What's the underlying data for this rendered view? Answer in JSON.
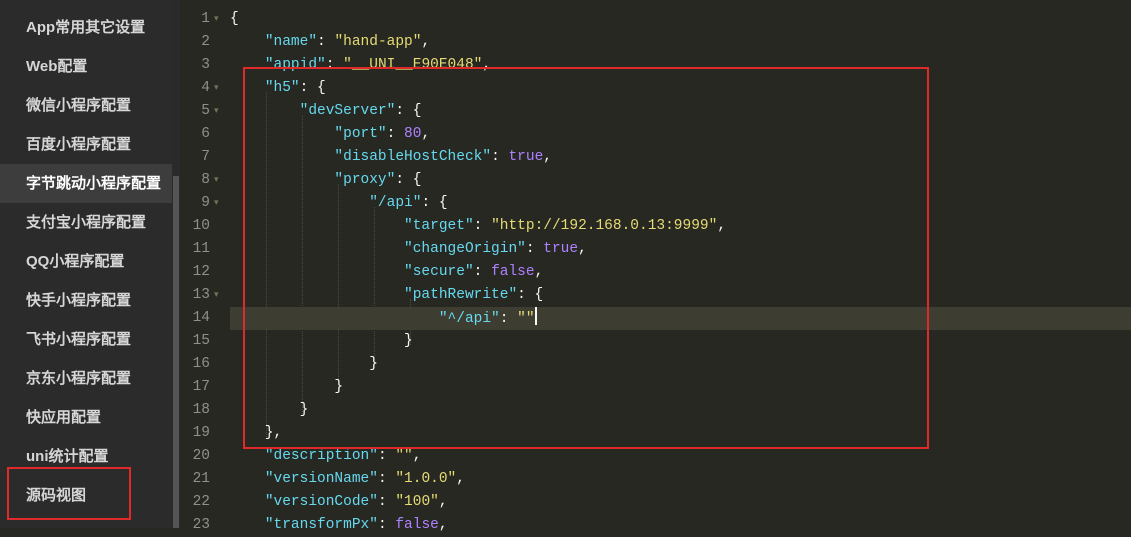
{
  "sidebar": {
    "items": [
      {
        "label": "App常用其它设置"
      },
      {
        "label": "Web配置"
      },
      {
        "label": "微信小程序配置"
      },
      {
        "label": "百度小程序配置"
      },
      {
        "label": "字节跳动小程序配置"
      },
      {
        "label": "支付宝小程序配置"
      },
      {
        "label": "QQ小程序配置"
      },
      {
        "label": "快手小程序配置"
      },
      {
        "label": "飞书小程序配置"
      },
      {
        "label": "京东小程序配置"
      },
      {
        "label": "快应用配置"
      },
      {
        "label": "uni统计配置"
      },
      {
        "label": "源码视图"
      }
    ],
    "active_index": 4
  },
  "editor": {
    "lines": [
      {
        "num": "1",
        "fold": true,
        "tokens": [
          [
            "p",
            "{"
          ]
        ]
      },
      {
        "num": "2",
        "fold": false,
        "tokens": [
          [
            "p",
            "    "
          ],
          [
            "k",
            "\"name\""
          ],
          [
            "p",
            ": "
          ],
          [
            "s",
            "\"hand-app\""
          ],
          [
            "p",
            ","
          ]
        ]
      },
      {
        "num": "3",
        "fold": false,
        "tokens": [
          [
            "p",
            "    "
          ],
          [
            "k",
            "\"appid\""
          ],
          [
            "p",
            ": "
          ],
          [
            "s",
            "\"__UNI__E90E048\""
          ],
          [
            "p",
            ","
          ]
        ]
      },
      {
        "num": "4",
        "fold": true,
        "tokens": [
          [
            "p",
            "    "
          ],
          [
            "k",
            "\"h5\""
          ],
          [
            "p",
            ": {"
          ]
        ]
      },
      {
        "num": "5",
        "fold": true,
        "tokens": [
          [
            "p",
            "        "
          ],
          [
            "k",
            "\"devServer\""
          ],
          [
            "p",
            ": {"
          ]
        ]
      },
      {
        "num": "6",
        "fold": false,
        "tokens": [
          [
            "p",
            "            "
          ],
          [
            "k",
            "\"port\""
          ],
          [
            "p",
            ": "
          ],
          [
            "n",
            "80"
          ],
          [
            "p",
            ","
          ]
        ]
      },
      {
        "num": "7",
        "fold": false,
        "tokens": [
          [
            "p",
            "            "
          ],
          [
            "k",
            "\"disableHostCheck\""
          ],
          [
            "p",
            ": "
          ],
          [
            "b",
            "true"
          ],
          [
            "p",
            ","
          ]
        ]
      },
      {
        "num": "8",
        "fold": true,
        "tokens": [
          [
            "p",
            "            "
          ],
          [
            "k",
            "\"proxy\""
          ],
          [
            "p",
            ": {"
          ]
        ]
      },
      {
        "num": "9",
        "fold": true,
        "tokens": [
          [
            "p",
            "                "
          ],
          [
            "k",
            "\"/api\""
          ],
          [
            "p",
            ": {"
          ]
        ]
      },
      {
        "num": "10",
        "fold": false,
        "tokens": [
          [
            "p",
            "                    "
          ],
          [
            "k",
            "\"target\""
          ],
          [
            "p",
            ": "
          ],
          [
            "s",
            "\"http://192.168.0.13:9999\""
          ],
          [
            "p",
            ","
          ]
        ]
      },
      {
        "num": "11",
        "fold": false,
        "tokens": [
          [
            "p",
            "                    "
          ],
          [
            "k",
            "\"changeOrigin\""
          ],
          [
            "p",
            ": "
          ],
          [
            "b",
            "true"
          ],
          [
            "p",
            ","
          ]
        ]
      },
      {
        "num": "12",
        "fold": false,
        "tokens": [
          [
            "p",
            "                    "
          ],
          [
            "k",
            "\"secure\""
          ],
          [
            "p",
            ": "
          ],
          [
            "b",
            "false"
          ],
          [
            "p",
            ","
          ]
        ]
      },
      {
        "num": "13",
        "fold": true,
        "tokens": [
          [
            "p",
            "                    "
          ],
          [
            "k",
            "\"pathRewrite\""
          ],
          [
            "p",
            ": {"
          ]
        ]
      },
      {
        "num": "14",
        "fold": false,
        "current": true,
        "tokens": [
          [
            "p",
            "                        "
          ],
          [
            "k",
            "\"^/api\""
          ],
          [
            "p",
            ": "
          ],
          [
            "s",
            "\"\""
          ]
        ]
      },
      {
        "num": "15",
        "fold": false,
        "tokens": [
          [
            "p",
            "                    }"
          ]
        ]
      },
      {
        "num": "16",
        "fold": false,
        "tokens": [
          [
            "p",
            "                }"
          ]
        ]
      },
      {
        "num": "17",
        "fold": false,
        "tokens": [
          [
            "p",
            "            }"
          ]
        ]
      },
      {
        "num": "18",
        "fold": false,
        "tokens": [
          [
            "p",
            "        }"
          ]
        ]
      },
      {
        "num": "19",
        "fold": false,
        "tokens": [
          [
            "p",
            "    },"
          ]
        ]
      },
      {
        "num": "20",
        "fold": false,
        "tokens": [
          [
            "p",
            "    "
          ],
          [
            "k",
            "\"description\""
          ],
          [
            "p",
            ": "
          ],
          [
            "s",
            "\"\""
          ],
          [
            "p",
            ","
          ]
        ]
      },
      {
        "num": "21",
        "fold": false,
        "tokens": [
          [
            "p",
            "    "
          ],
          [
            "k",
            "\"versionName\""
          ],
          [
            "p",
            ": "
          ],
          [
            "s",
            "\"1.0.0\""
          ],
          [
            "p",
            ","
          ]
        ]
      },
      {
        "num": "22",
        "fold": false,
        "tokens": [
          [
            "p",
            "    "
          ],
          [
            "k",
            "\"versionCode\""
          ],
          [
            "p",
            ": "
          ],
          [
            "s",
            "\"100\""
          ],
          [
            "p",
            ","
          ]
        ]
      },
      {
        "num": "23",
        "fold": false,
        "tokens": [
          [
            "p",
            "    "
          ],
          [
            "k",
            "\"transformPx\""
          ],
          [
            "p",
            ": "
          ],
          [
            "b",
            "false"
          ],
          [
            "p",
            ","
          ]
        ]
      }
    ]
  },
  "icons": {
    "fold_marker": "fold-arrow-icon"
  },
  "colors": {
    "background": "#272822",
    "key": "#66d9ef",
    "string": "#e6db74",
    "number": "#ae81ff",
    "highlight_box": "#e02a2a"
  }
}
